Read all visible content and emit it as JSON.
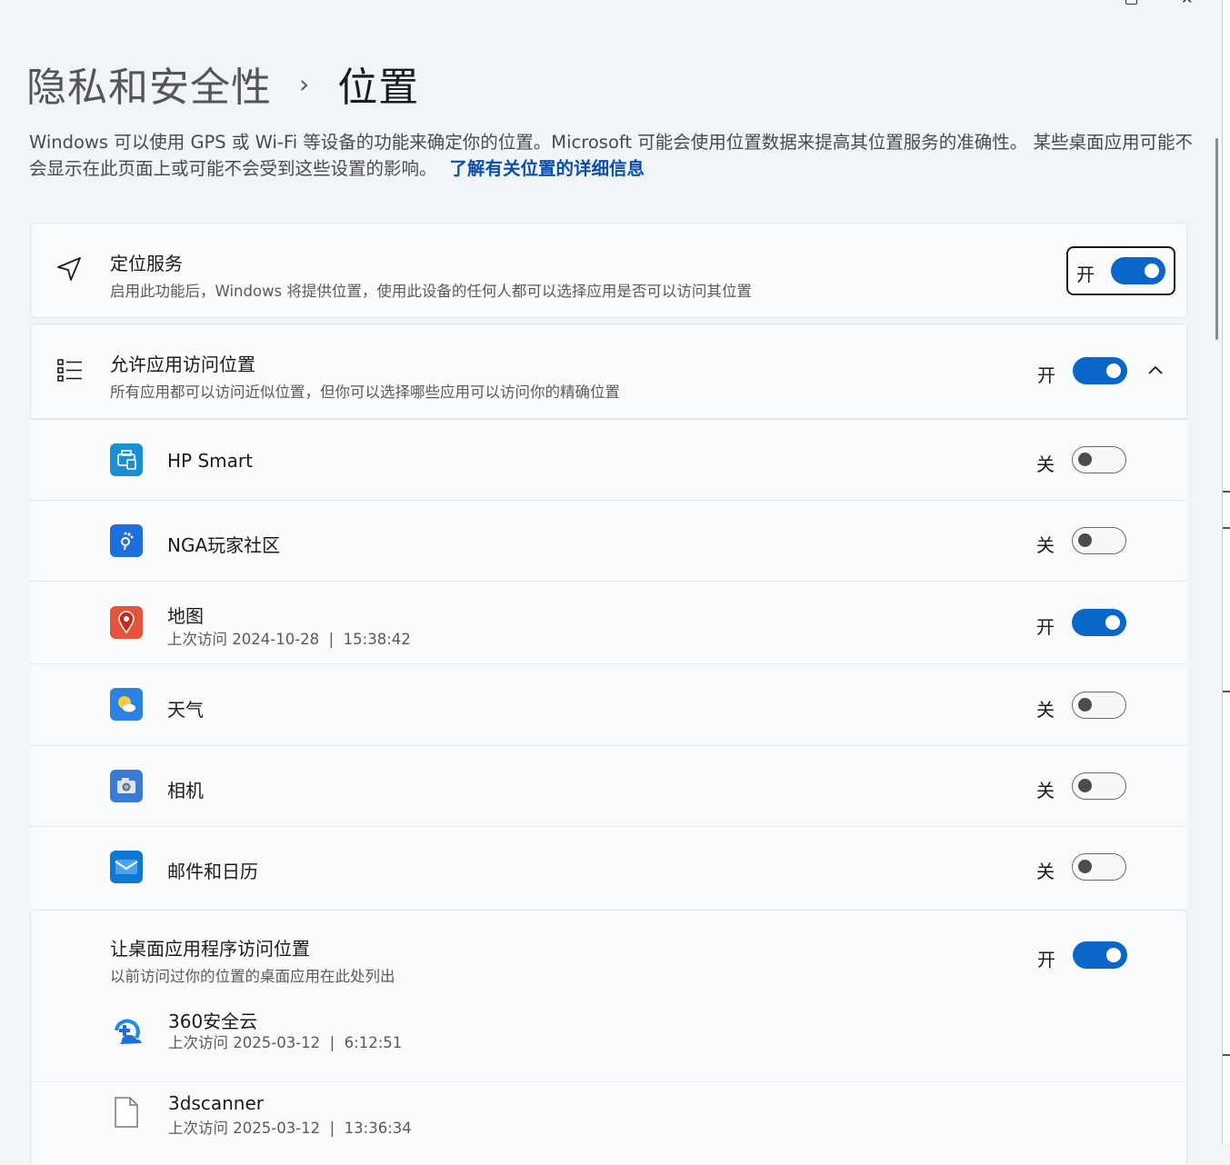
{
  "breadcrumb": {
    "parent": "隐私和安全性",
    "separator": "›",
    "current": "位置"
  },
  "description": {
    "text": "Windows 可以使用 GPS 或 Wi-Fi 等设备的功能来确定你的位置。Microsoft 可能会使用位置数据来提高其位置服务的准确性。 某些桌面应用可能不会显示在此页面上或可能不会受到这些设置的影响。",
    "link": "了解有关位置的详细信息"
  },
  "location_service": {
    "title": "定位服务",
    "subtitle": "启用此功能后，Windows 将提供位置，使用此设备的任何人都可以选择应用是否可以访问其位置",
    "state": "开"
  },
  "app_access": {
    "title": "允许应用访问位置",
    "subtitle": "所有应用都可以访问近似位置，但你可以选择哪些应用可以访问你的精确位置",
    "state": "开"
  },
  "apps": [
    {
      "name": "HP Smart",
      "state": "关",
      "icon": "hp-smart-icon"
    },
    {
      "name": "NGA玩家社区",
      "state": "关",
      "icon": "nga-icon"
    },
    {
      "name": "地图",
      "sub": "上次访问 2024-10-28  |  15:38:42",
      "state": "开",
      "icon": "maps-icon"
    },
    {
      "name": "天气",
      "state": "关",
      "icon": "weather-icon"
    },
    {
      "name": "相机",
      "state": "关",
      "icon": "camera-icon"
    },
    {
      "name": "邮件和日历",
      "state": "关",
      "icon": "mail-icon"
    }
  ],
  "desktop_access": {
    "title": "让桌面应用程序访问位置",
    "subtitle": "以前访问过你的位置的桌面应用在此处列出",
    "state": "开"
  },
  "desktop_apps": [
    {
      "name": "360安全云",
      "sub": "上次访问 2025-03-12  |  6:12:51",
      "icon": "360-cloud-icon"
    },
    {
      "name": "3dscanner",
      "sub": "上次访问 2025-03-12  |  13:36:34",
      "icon": "file-icon"
    }
  ],
  "colors": {
    "accent": "#0a67c9",
    "link": "#0a4ea8",
    "background": "#f1f4f9",
    "card": "#fafbfd"
  }
}
